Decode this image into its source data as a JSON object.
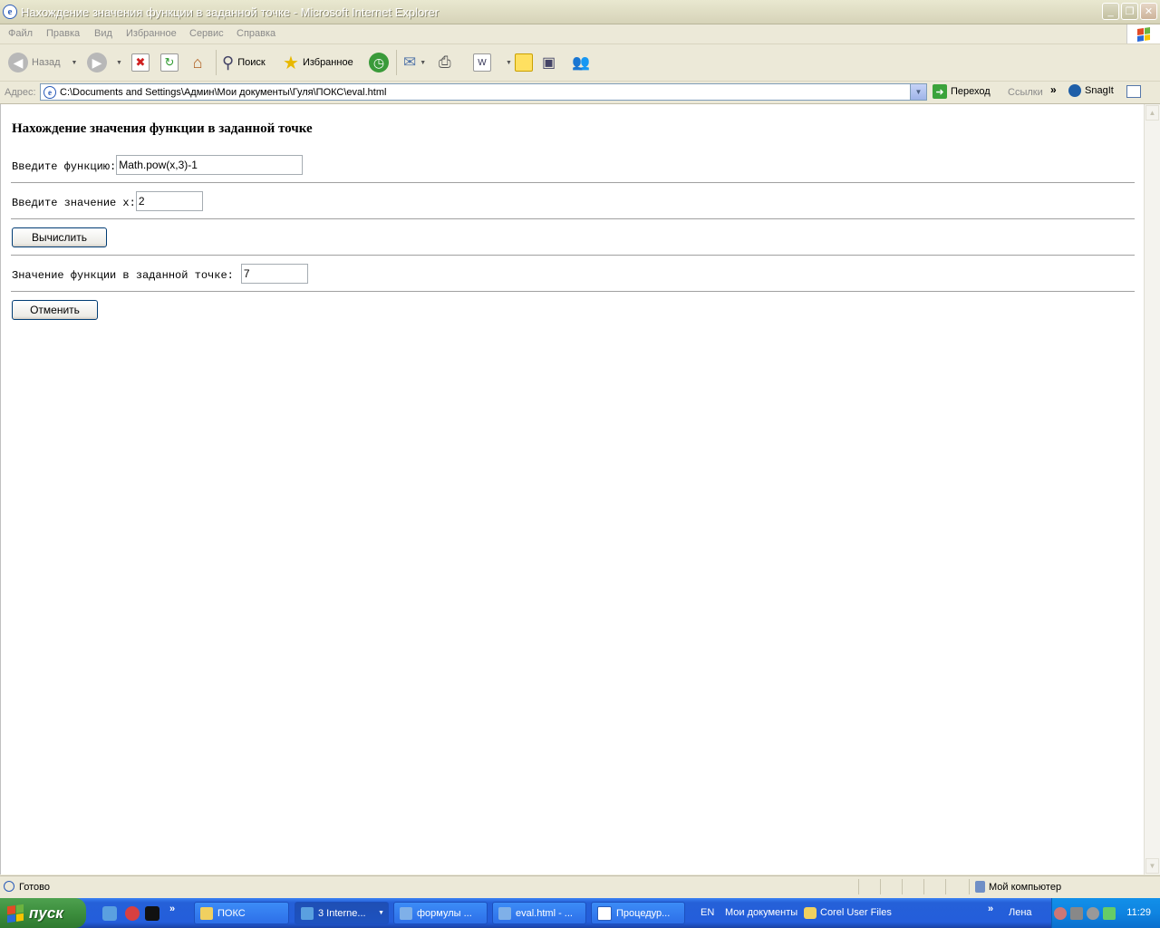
{
  "window": {
    "title": "Нахождение значения функции в заданной точке - Microsoft Internet Explorer"
  },
  "menu": [
    "Файл",
    "Правка",
    "Вид",
    "Избранное",
    "Сервис",
    "Справка"
  ],
  "toolbar": {
    "back_label": "Назад",
    "search_label": "Поиск",
    "favorites_label": "Избранное"
  },
  "address": {
    "label": "Адрес:",
    "url": "C:\\Documents and Settings\\Админ\\Мои документы\\Гуля\\ПОКС\\eval.html",
    "go_label": "Переход",
    "links_label": "Ссылки",
    "chevron": "»",
    "snagit_label": "SnagIt"
  },
  "page": {
    "heading": "Нахождение значения функции в заданной точке",
    "function_label": "Введите функцию:",
    "function_value": "Math.pow(x,3)-1",
    "x_label": "Введите значение x:",
    "x_value": "2",
    "calc_button": "Вычислить",
    "result_label": "Значение функции в заданной точке:",
    "result_value": "7",
    "cancel_button": "Отменить"
  },
  "status": {
    "text": "Готово",
    "zone": "Мой компьютер"
  },
  "taskbar": {
    "start_label": "пуск",
    "quicklaunch_more": "»",
    "buttons": [
      {
        "label": "ПОКС"
      },
      {
        "label": "3 Interne..."
      },
      {
        "label": "формулы ..."
      },
      {
        "label": "eval.html - ..."
      },
      {
        "label": "Процедур..."
      }
    ],
    "lang": "EN",
    "toolbar_items": [
      "Мои документы",
      "Corel User Files"
    ],
    "user": "Лена",
    "user_more": "»",
    "clock": "11:29"
  },
  "colors": {
    "taskbar_blue": "#245edb",
    "start_green": "#3c8e3d",
    "content_bg": "#ffffff",
    "chrome_bg": "#ece9d8"
  }
}
